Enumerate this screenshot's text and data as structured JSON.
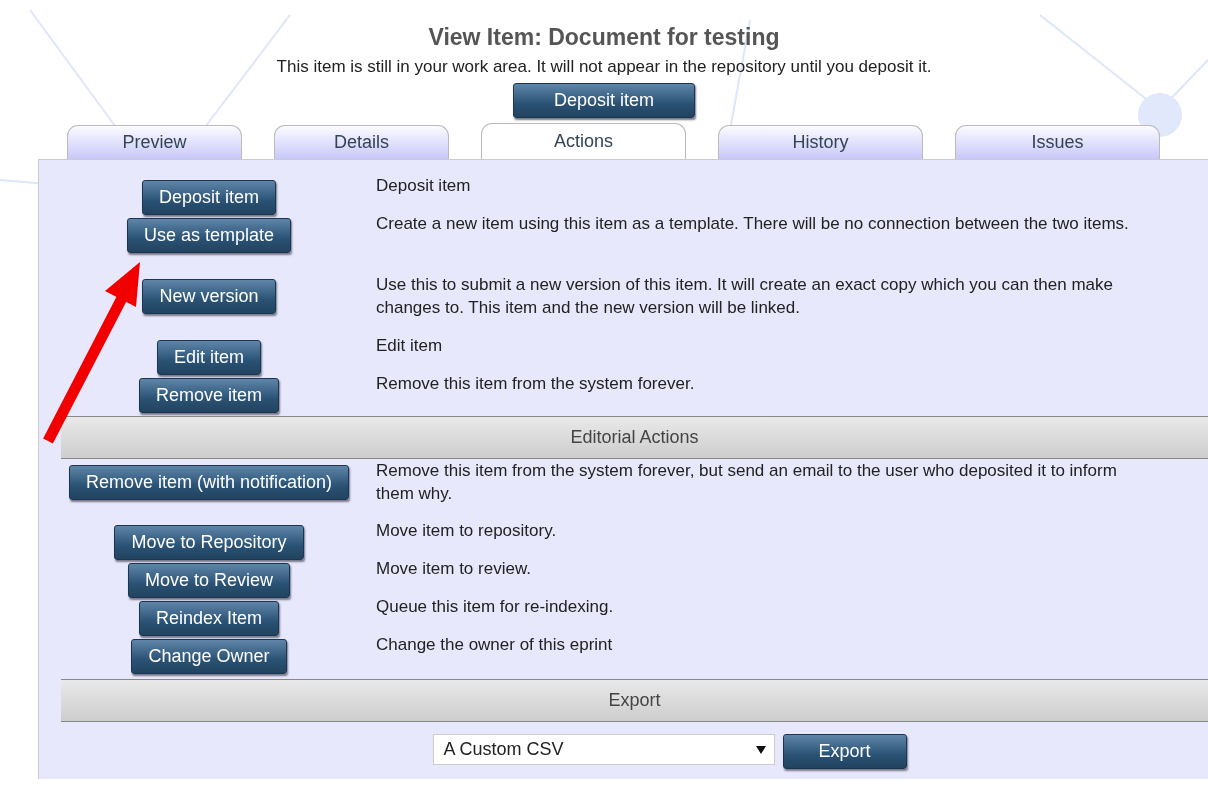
{
  "page": {
    "title": "View Item: Document for testing",
    "notice": "This item is still in your work area. It will not appear in the repository until you deposit it.",
    "deposit_button": "Deposit item"
  },
  "tabs": [
    {
      "label": "Preview",
      "selected": false
    },
    {
      "label": "Details",
      "selected": false
    },
    {
      "label": "Actions",
      "selected": true
    },
    {
      "label": "History",
      "selected": false
    },
    {
      "label": "Issues",
      "selected": false
    }
  ],
  "sections": [
    {
      "actions": [
        {
          "button": "Deposit item",
          "description": "Deposit item"
        },
        {
          "button": "Use as template",
          "description": "Create a new item using this item as a template. There will be no connection between the two items."
        },
        {
          "button": "New version",
          "description": "Use this to submit a new version of this item. It will create an exact copy which you can then make changes to. This item and the new version will be linked."
        },
        {
          "button": "Edit item",
          "description": "Edit item"
        },
        {
          "button": "Remove item",
          "description": "Remove this item from the system forever."
        }
      ]
    },
    {
      "heading": "Editorial Actions",
      "actions": [
        {
          "button": "Remove item (with notification)",
          "description": "Remove this item from the system forever, but send an email to the user who deposited it to inform them why."
        },
        {
          "button": "Move to Repository",
          "description": "Move item to repository."
        },
        {
          "button": "Move to Review",
          "description": "Move item to review."
        },
        {
          "button": "Reindex Item",
          "description": "Queue this item for re-indexing."
        },
        {
          "button": "Change Owner",
          "description": "Change the owner of this eprint"
        }
      ]
    }
  ],
  "export": {
    "heading": "Export",
    "format": "A Custom CSV",
    "button": "Export"
  }
}
